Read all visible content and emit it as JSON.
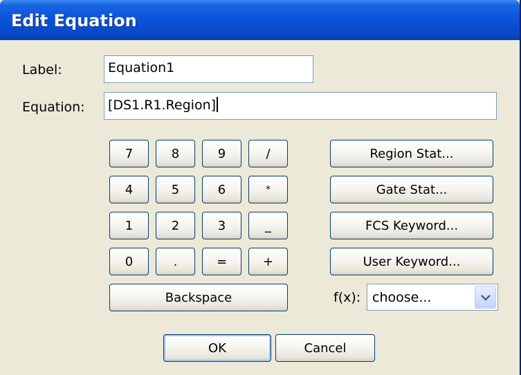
{
  "window": {
    "title": "Edit Equation"
  },
  "form": {
    "label_caption": "Label:",
    "label_value": "Equation1",
    "equation_caption": "Equation:",
    "equation_value": "[DS1.R1.Region]"
  },
  "keypad": {
    "keys": [
      "7",
      "8",
      "9",
      "/",
      "4",
      "5",
      "6",
      "*",
      "1",
      "2",
      "3",
      "_",
      "0",
      ".",
      "=",
      "+"
    ],
    "backspace": "Backspace"
  },
  "side_buttons": {
    "region_stat": "Region Stat...",
    "gate_stat": "Gate Stat...",
    "fcs_keyword": "FCS Keyword...",
    "user_keyword": "User Keyword..."
  },
  "function": {
    "caption": "f(x):",
    "selected": "choose..."
  },
  "footer": {
    "ok": "OK",
    "cancel": "Cancel"
  },
  "colors": {
    "titlebar": "#0a54da",
    "dialog_bg": "#ece9d8",
    "field_border": "#7f9db9",
    "button_border": "#003c74"
  }
}
